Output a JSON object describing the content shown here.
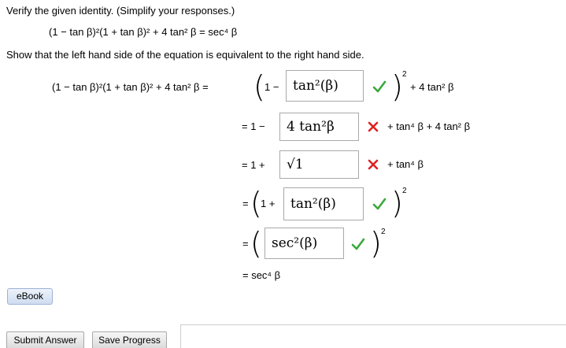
{
  "instruction": "Verify the given identity. (Simplify your responses.)",
  "given_identity": "(1 − tan β)²(1 + tan β)² + 4 tan² β = sec⁴ β",
  "show_text": "Show that the left hand side of the equation is equivalent to the right hand side.",
  "lhs": "(1 − tan β)²(1 + tan β)² + 4 tan² β =",
  "steps": [
    {
      "prefix": "1 −",
      "answer": "tan²(β)",
      "status": "correct",
      "suffix": "+ 4 tan² β",
      "outer_exponent": "2"
    },
    {
      "prefix": "= 1 −",
      "answer": "4 tan²β",
      "status": "incorrect",
      "suffix": "+ tan⁴ β + 4 tan² β"
    },
    {
      "prefix": "= 1 +",
      "answer": "√1",
      "status": "incorrect",
      "suffix": "+ tan⁴ β"
    },
    {
      "prefix": "1 +",
      "answer": "tan²(β)",
      "status": "correct",
      "outer_exponent": "2"
    },
    {
      "answer": "sec²(β)",
      "status": "correct",
      "outer_exponent": "2"
    },
    {
      "result": "= sec⁴ β"
    }
  ],
  "buttons": {
    "ebook": "eBook",
    "submit": "Submit Answer",
    "save": "Save Progress"
  },
  "colors": {
    "correct": "#3aa83a",
    "incorrect": "#e02020",
    "ebook_bg": "#dbe6f6"
  }
}
